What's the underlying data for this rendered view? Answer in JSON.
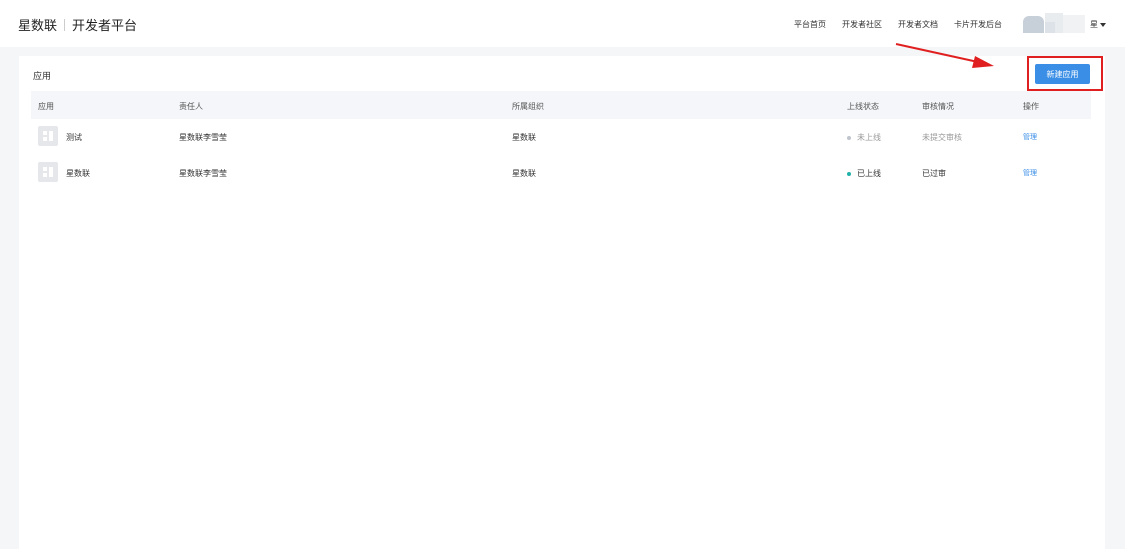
{
  "header": {
    "brand_name": "星数联",
    "platform_name": "开发者平台",
    "nav": [
      "平台首页",
      "开发者社区",
      "开发者文档",
      "卡片开发后台"
    ],
    "user_initial": "星"
  },
  "panel": {
    "title": "应用",
    "new_button": "新建应用"
  },
  "table": {
    "columns": [
      "应用",
      "责任人",
      "所属组织",
      "上线状态",
      "审核情况",
      "操作"
    ],
    "rows": [
      {
        "app": "测试",
        "owner": "星数联李雪莹",
        "org": "星数联",
        "status": "未上线",
        "review": "未提交审核",
        "action": "管理"
      },
      {
        "app": "星数联",
        "owner": "星数联李雪莹",
        "org": "星数联",
        "status": "已上线",
        "review": "已过审",
        "action": "管理"
      }
    ]
  },
  "colors": {
    "accent": "#3a8ee6",
    "online": "#20b2aa",
    "offline": "#c0c4cc",
    "annotation": "#e02020"
  }
}
